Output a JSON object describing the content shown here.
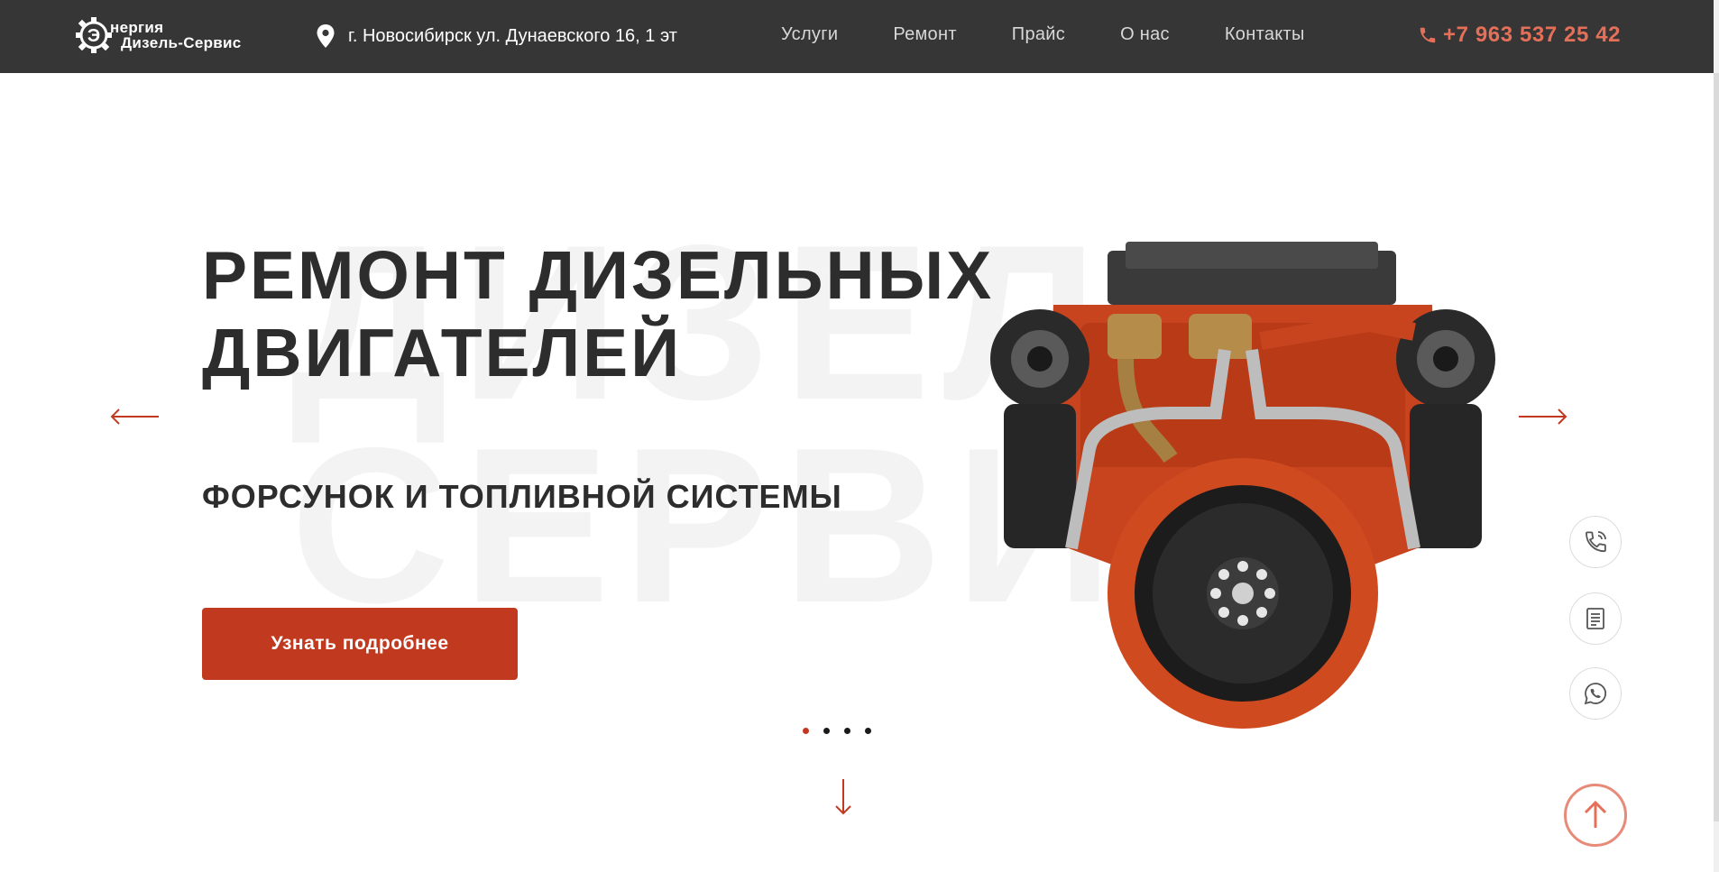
{
  "header": {
    "logo": {
      "line1": "нергия",
      "line2": "Дизель-Сервис",
      "mark_letter": "Э"
    },
    "address": "г. Новосибирск ул. Дунаевского 16, 1 эт",
    "nav": [
      {
        "label": "Услуги"
      },
      {
        "label": "Ремонт"
      },
      {
        "label": "Прайс"
      },
      {
        "label": "О нас"
      },
      {
        "label": "Контакты"
      }
    ],
    "phone": "+7 963 537 25 42"
  },
  "hero": {
    "watermark": "ДИЗЕЛЬ\nСЕРВИС",
    "title": "РЕМОНТ ДИЗЕЛЬНЫХ ДВИГАТЕЛЕЙ",
    "subtitle": "ФОРСУНОК И ТОПЛИВНОЙ СИСТЕМЫ",
    "cta_label": "Узнать подробнее",
    "slides_total": 4,
    "active_slide": 1
  },
  "icons": {
    "logo": "gear-logo-icon",
    "address": "location-pin-icon",
    "phone": "phone-icon",
    "prev": "arrow-left-icon",
    "next": "arrow-right-icon",
    "scroll_down": "arrow-down-icon",
    "side_call": "phone-call-icon",
    "side_doc": "document-icon",
    "side_wa": "whatsapp-icon",
    "to_top": "arrow-up-icon"
  },
  "colors": {
    "header_bg": "#363636",
    "accent": "#c13a20",
    "phone": "#e5705a",
    "text_dark": "#2d2d2d"
  }
}
